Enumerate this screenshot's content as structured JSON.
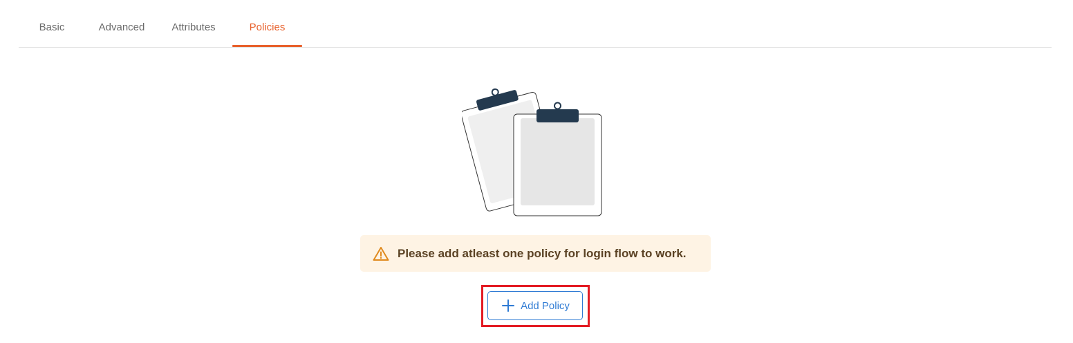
{
  "tabs": [
    {
      "label": "Basic",
      "active": false
    },
    {
      "label": "Advanced",
      "active": false
    },
    {
      "label": "Attributes",
      "active": false
    },
    {
      "label": "Policies",
      "active": true
    }
  ],
  "empty_state": {
    "illustration": "clipboards-icon"
  },
  "alert": {
    "icon": "warning-icon",
    "message": "Please add atleast one policy for login flow to work."
  },
  "actions": {
    "add_policy_label": "Add Policy",
    "add_policy_icon": "plus-icon"
  },
  "colors": {
    "accent": "#e8612c",
    "primary": "#2f7bd4",
    "alert_bg": "#fef3e4",
    "highlight": "#e31b23"
  }
}
